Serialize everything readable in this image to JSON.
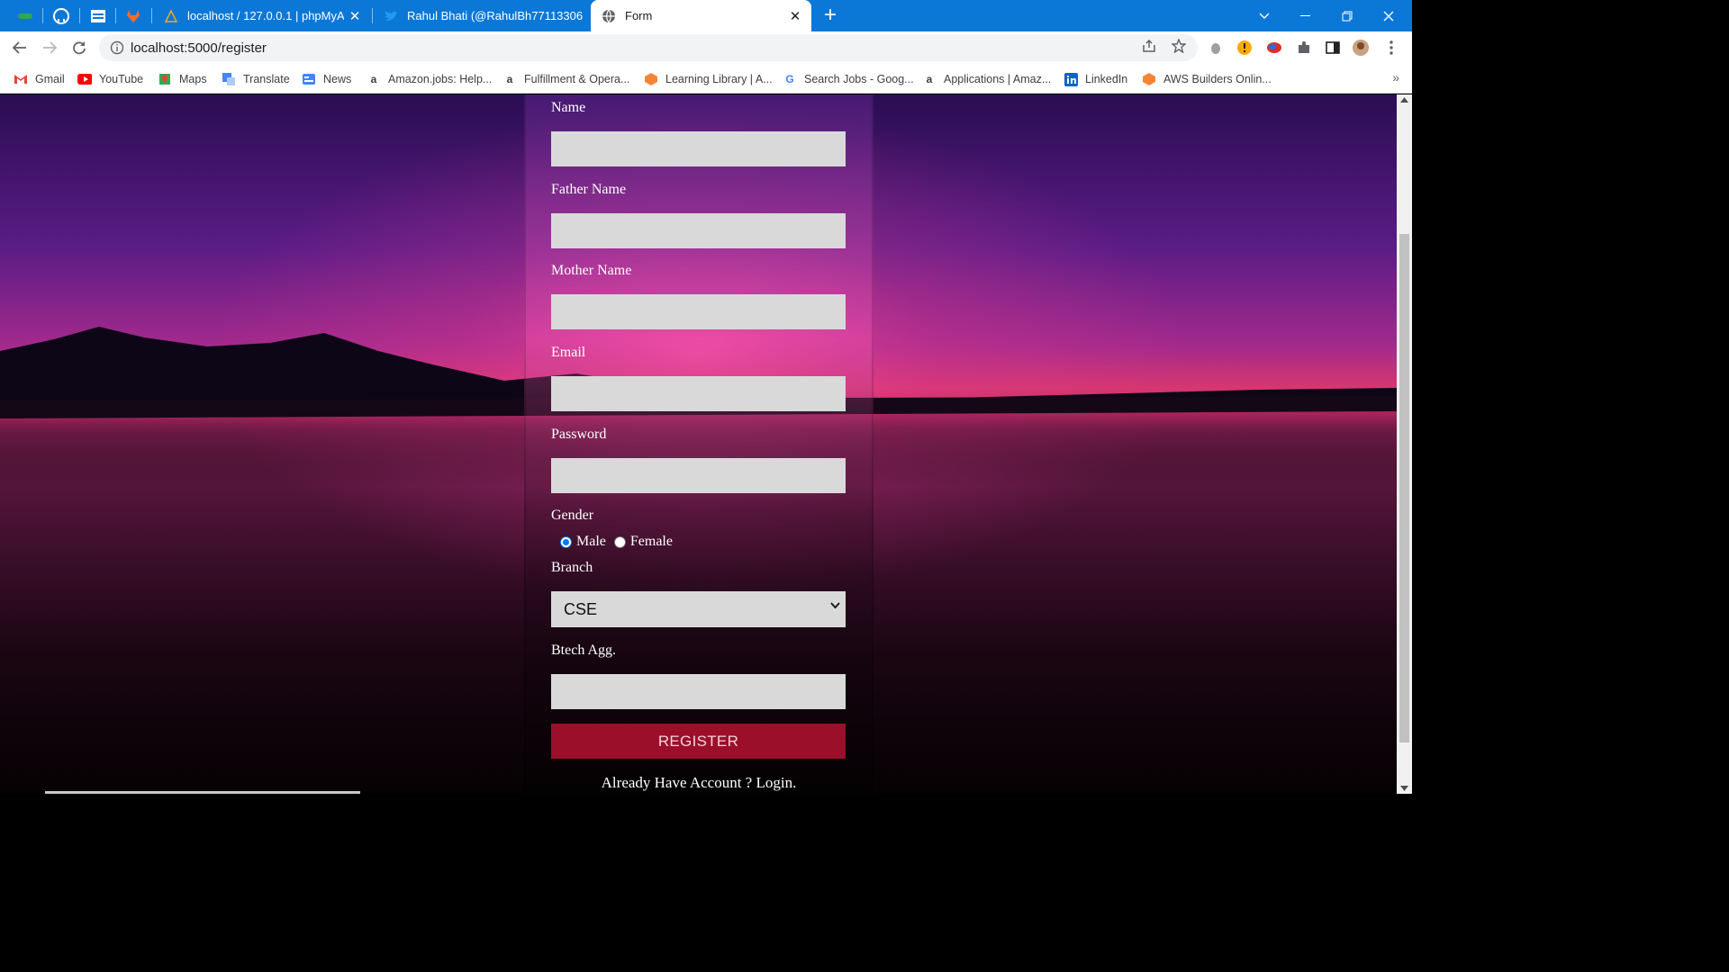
{
  "browser": {
    "tabs": [
      {
        "title": "localhost / 127.0.0.1 | phpMyAdmin",
        "icon": "phpmyadmin-icon"
      },
      {
        "title": "Rahul Bhati (@RahulBh77113306",
        "icon": "twitter-icon"
      },
      {
        "title": "Form",
        "icon": "globe-icon",
        "active": true
      }
    ],
    "close_glyph": "✕",
    "new_tab_glyph": "+",
    "address": "localhost:5000/register"
  },
  "bookmarks": [
    {
      "label": "Gmail",
      "icon": "gmail-icon"
    },
    {
      "label": "YouTube",
      "icon": "youtube-icon"
    },
    {
      "label": "Maps",
      "icon": "maps-icon"
    },
    {
      "label": "Translate",
      "icon": "translate-icon"
    },
    {
      "label": "News",
      "icon": "news-icon"
    },
    {
      "label": "Amazon.jobs: Help...",
      "icon": "amazon-icon"
    },
    {
      "label": "Fulfillment & Opera...",
      "icon": "amazon-icon"
    },
    {
      "label": "Learning Library | A...",
      "icon": "aws-icon"
    },
    {
      "label": "Search Jobs - Goog...",
      "icon": "google-icon"
    },
    {
      "label": "Applications | Amaz...",
      "icon": "amazon-icon"
    },
    {
      "label": "LinkedIn",
      "icon": "linkedin-icon"
    },
    {
      "label": "AWS Builders Onlin...",
      "icon": "aws-icon"
    }
  ],
  "bookmarks_more": "»",
  "form": {
    "labels": {
      "name": "Name",
      "father_name": "Father Name",
      "mother_name": "Mother Name",
      "email": "Email",
      "password": "Password",
      "gender": "Gender",
      "branch": "Branch",
      "btech_agg": "Btech Agg."
    },
    "values": {
      "name": "",
      "father_name": "",
      "mother_name": "",
      "email": "",
      "password": "",
      "btech_agg": ""
    },
    "gender_options": {
      "male": "Male",
      "female": "Female",
      "selected": "Male"
    },
    "branch_selected": "CSE",
    "register_label": "REGISTER",
    "login_text": "Already Have Account ? Login."
  },
  "colors": {
    "tabstrip": "#0b78d7",
    "input_bg": "#d9d9d9",
    "register_bg": "#9b0f2b",
    "radio_accent": "#0075ff"
  }
}
